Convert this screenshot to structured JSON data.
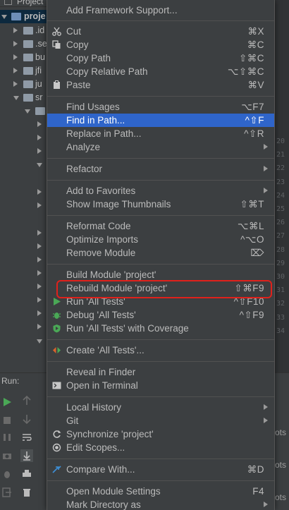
{
  "project_panel": {
    "header": "Project",
    "tree": [
      {
        "label": "proje",
        "expanded": true,
        "selected": true,
        "indent": 0
      },
      {
        "label": ".id",
        "expanded": false,
        "indent": 1
      },
      {
        "label": ".se",
        "expanded": false,
        "indent": 1
      },
      {
        "label": "bu",
        "expanded": false,
        "indent": 1
      },
      {
        "label": "jfi",
        "expanded": false,
        "indent": 1
      },
      {
        "label": "ju",
        "expanded": false,
        "indent": 1
      },
      {
        "label": "sr",
        "expanded": true,
        "indent": 1
      }
    ]
  },
  "gutter_numbers": [
    "20",
    "21",
    "22",
    "23",
    "24",
    "25",
    "26",
    "27",
    "28",
    "29",
    "30",
    "31",
    "32",
    "33",
    "34"
  ],
  "run_panel": {
    "label": "Run:",
    "right_texts": [
      "ots",
      "ots",
      "ots"
    ]
  },
  "context_menu": {
    "items": [
      {
        "label": "Add Framework Support...",
        "shortcut": "",
        "icon": "",
        "submenu": false
      },
      {
        "label": "Cut",
        "shortcut": "⌘X",
        "icon": "scissors-icon",
        "submenu": false
      },
      {
        "label": "Copy",
        "shortcut": "⌘C",
        "icon": "copy-icon",
        "submenu": false
      },
      {
        "label": "Copy Path",
        "shortcut": "⇧⌘C",
        "icon": "",
        "submenu": false
      },
      {
        "label": "Copy Relative Path",
        "shortcut": "⌥⇧⌘C",
        "icon": "",
        "submenu": false
      },
      {
        "label": "Paste",
        "shortcut": "⌘V",
        "icon": "paste-icon",
        "submenu": false
      },
      {
        "label": "Find Usages",
        "shortcut": "⌥F7",
        "icon": "",
        "submenu": false
      },
      {
        "label": "Find in Path...",
        "shortcut": "^⇧F",
        "icon": "",
        "submenu": false,
        "active": true
      },
      {
        "label": "Replace in Path...",
        "shortcut": "^⇧R",
        "icon": "",
        "submenu": false
      },
      {
        "label": "Analyze",
        "shortcut": "",
        "icon": "",
        "submenu": true
      },
      {
        "label": "Refactor",
        "shortcut": "",
        "icon": "",
        "submenu": true
      },
      {
        "label": "Add to Favorites",
        "shortcut": "",
        "icon": "",
        "submenu": true
      },
      {
        "label": "Show Image Thumbnails",
        "shortcut": "⇧⌘T",
        "icon": "",
        "submenu": false
      },
      {
        "label": "Reformat Code",
        "shortcut": "⌥⌘L",
        "icon": "",
        "submenu": false
      },
      {
        "label": "Optimize Imports",
        "shortcut": "^⌥O",
        "icon": "",
        "submenu": false
      },
      {
        "label": "Remove Module",
        "shortcut": "⌦",
        "icon": "",
        "submenu": false
      },
      {
        "label": "Build Module 'project'",
        "shortcut": "",
        "icon": "",
        "submenu": false
      },
      {
        "label": "Rebuild Module 'project'",
        "shortcut": "⇧⌘F9",
        "icon": "",
        "submenu": false
      },
      {
        "label": "Run 'All Tests'",
        "shortcut": "^⇧F10",
        "icon": "run-icon",
        "submenu": false
      },
      {
        "label": "Debug 'All Tests'",
        "shortcut": "^⇧F9",
        "icon": "debug-icon",
        "submenu": false
      },
      {
        "label": "Run 'All Tests' with Coverage",
        "shortcut": "",
        "icon": "coverage-icon",
        "submenu": false
      },
      {
        "label": "Create 'All Tests'...",
        "shortcut": "",
        "icon": "create-test-icon",
        "submenu": false
      },
      {
        "label": "Reveal in Finder",
        "shortcut": "",
        "icon": "",
        "submenu": false
      },
      {
        "label": "Open in Terminal",
        "shortcut": "",
        "icon": "terminal-icon",
        "submenu": false
      },
      {
        "label": "Local History",
        "shortcut": "",
        "icon": "",
        "submenu": true
      },
      {
        "label": "Git",
        "shortcut": "",
        "icon": "",
        "submenu": true
      },
      {
        "label": "Synchronize 'project'",
        "shortcut": "",
        "icon": "sync-icon",
        "submenu": false
      },
      {
        "label": "Edit Scopes...",
        "shortcut": "",
        "icon": "scope-icon",
        "submenu": false
      },
      {
        "label": "Compare With...",
        "shortcut": "⌘D",
        "icon": "compare-icon",
        "submenu": false
      },
      {
        "label": "Open Module Settings",
        "shortcut": "F4",
        "icon": "",
        "submenu": false
      },
      {
        "label": "Mark Directory as",
        "shortcut": "",
        "icon": "",
        "submenu": true
      }
    ]
  },
  "colors": {
    "menu_bg": "#3c3f41",
    "active_item": "#2f65ca",
    "highlight_outline": "#e0211b",
    "run_green": "#4aa856"
  }
}
